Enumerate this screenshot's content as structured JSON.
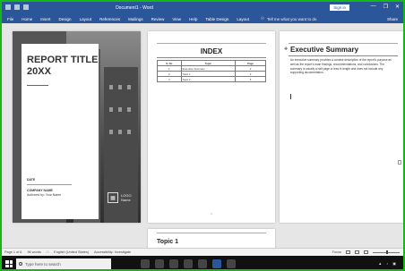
{
  "app": {
    "title": "Document1 - Word",
    "sign_in": "Sign in",
    "window_controls": [
      "—",
      "❐",
      "✕"
    ],
    "colors": {
      "ribbon": "#2b579a",
      "frame": "#16b816"
    }
  },
  "menu": {
    "items": [
      "File",
      "Home",
      "Insert",
      "Design",
      "Layout",
      "References",
      "Mailings",
      "Review",
      "View",
      "Help",
      "Table Design",
      "Layout"
    ],
    "tell_me": "Tell me what you want to do",
    "share": "Share"
  },
  "cover": {
    "title_line1": "REPORT TITLE",
    "title_line2": "20XX",
    "date_label": "DATE",
    "company_line1": "COMPANY NAME",
    "company_line2": "Authored by: Your Name",
    "logo_line1": "LOGO",
    "logo_line2": "Name"
  },
  "index_page": {
    "heading": "INDEX",
    "columns": [
      "S. No",
      "Topic",
      "Page"
    ],
    "rows": [
      {
        "no": "1",
        "topic": "Executive Summary",
        "page": "2"
      },
      {
        "no": "2",
        "topic": "Topic 1",
        "page": "3"
      },
      {
        "no": "3",
        "topic": "Topic 2",
        "page": "5"
      }
    ],
    "page_number": "1"
  },
  "exec_page": {
    "heading": "Executive Summary",
    "body": "An executive summary provides a concise description of the report's purpose as well as the report's main findings, recommendations, and conclusions. The summary is usually a half page or less in length and does not include any supporting documentation."
  },
  "topic_page": {
    "heading": "Topic 1"
  },
  "status": {
    "page": "Page 1 of 6",
    "words": "96 words",
    "language": "English (United States)",
    "accessibility": "Accessibility: Investigate",
    "zoom": "Focus"
  },
  "taskbar": {
    "search_placeholder": "Type here to search"
  }
}
